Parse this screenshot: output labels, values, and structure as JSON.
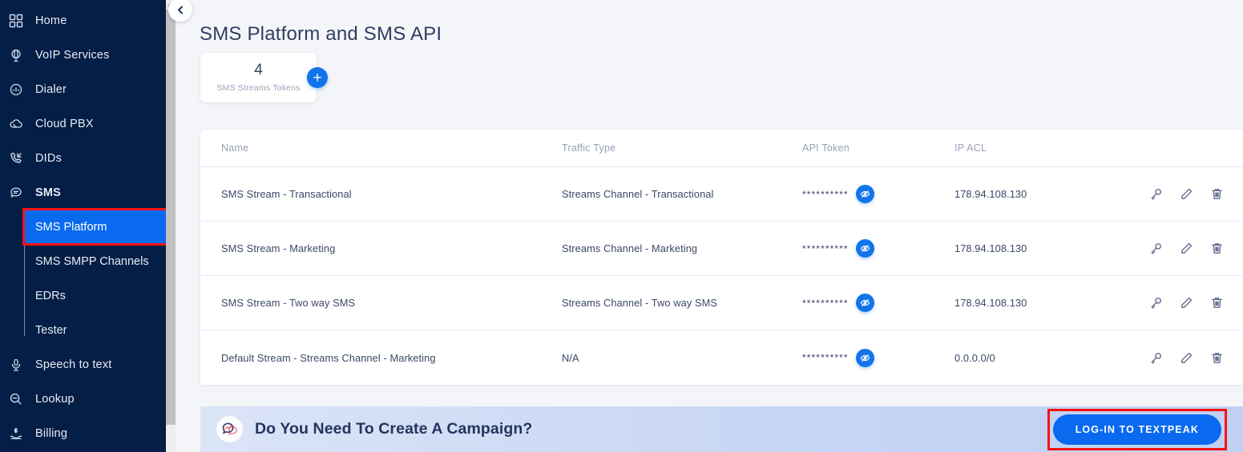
{
  "sidebar": {
    "items": [
      {
        "label": "Home",
        "icon": "grid-icon"
      },
      {
        "label": "VoIP Services",
        "icon": "globe-icon"
      },
      {
        "label": "Dialer",
        "icon": "headset-icon"
      },
      {
        "label": "Cloud PBX",
        "icon": "cloud-phone-icon"
      },
      {
        "label": "DIDs",
        "icon": "phone-incoming-icon"
      },
      {
        "label": "SMS",
        "icon": "chat-bubble-icon"
      }
    ],
    "sub_items": [
      {
        "label": "SMS Platform",
        "active": true
      },
      {
        "label": "SMS SMPP Channels",
        "active": false
      },
      {
        "label": "EDRs",
        "active": false
      },
      {
        "label": "Tester",
        "active": false
      }
    ],
    "items_after": [
      {
        "label": "Speech to text",
        "icon": "microphone-icon"
      },
      {
        "label": "Lookup",
        "icon": "magnifier-minus-icon"
      },
      {
        "label": "Billing",
        "icon": "billing-hand-icon"
      }
    ],
    "collapse_icon": "chevron-left-icon",
    "active_highlight_color": "#0a6aef",
    "highlight_outline_color": "#f71111",
    "background_color": "#041E46"
  },
  "header": {
    "title": "SMS Platform and SMS API"
  },
  "stat_card": {
    "value": "4",
    "caption": "SMS Streams Tokens",
    "add_label": "+",
    "add_icon": "plus-icon"
  },
  "table": {
    "columns": [
      "Name",
      "Traffic Type",
      "API Token",
      "IP ACL"
    ],
    "rows": [
      {
        "name": "SMS Stream - Transactional",
        "traffic_type": "Streams Channel - Transactional",
        "api_token": "**********",
        "ip_acl": "178.94.108.130"
      },
      {
        "name": "SMS Stream - Marketing",
        "traffic_type": "Streams Channel - Marketing",
        "api_token": "**********",
        "ip_acl": "178.94.108.130"
      },
      {
        "name": "SMS Stream - Two way SMS",
        "traffic_type": "Streams Channel - Two way SMS",
        "api_token": "**********",
        "ip_acl": "178.94.108.130"
      },
      {
        "name": "Default Stream - Streams Channel - Marketing",
        "traffic_type": "N/A",
        "api_token": "**********",
        "ip_acl": "0.0.0.0/0"
      }
    ],
    "row_actions": [
      "key-icon",
      "pencil-icon",
      "trash-icon"
    ],
    "reveal_icon": "eye-slash-icon"
  },
  "banner": {
    "icon": "campaign-chat-chart-icon",
    "title": "Do You Need To Create A Campaign?",
    "cta_label": "LOG-IN TO TEXTPEAK",
    "cta_color": "#0a6aef",
    "cta_outline_color": "#f71111"
  }
}
